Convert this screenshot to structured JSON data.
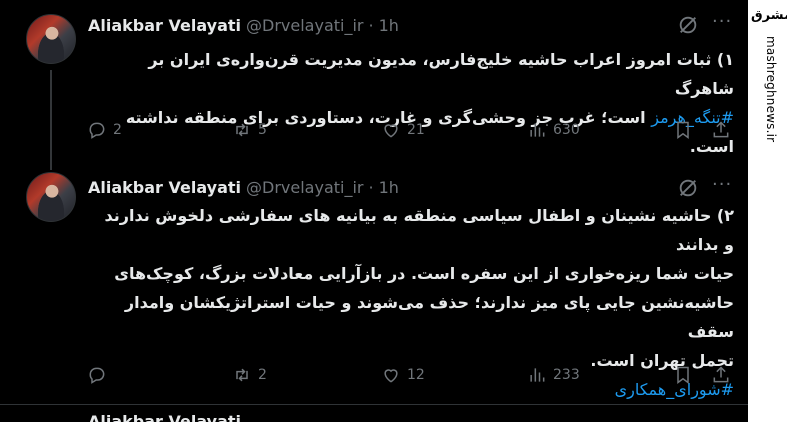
{
  "tweets": [
    {
      "author_name": "Aliakbar Velayati",
      "author_handle": "@Drvelayati_ir",
      "separator": "·",
      "time": "1h",
      "text_lines": [
        "۱) ثبات امروز اعراب حاشیه خلیج‌فارس، مدیون مدیریت قرن‌واره‌ی ایران بر شاهرگ",
        "است؛ غرب جز وحشی‌گری و غارت، دستاوردی برای منطقه نداشته است."
      ],
      "hashtag": "#تنگه_هرمز",
      "replies": "2",
      "reposts": "5",
      "likes": "21",
      "views": "630"
    },
    {
      "author_name": "Aliakbar Velayati",
      "author_handle": "@Drvelayati_ir",
      "separator": "·",
      "time": "1h",
      "text_lines": [
        "۲) حاشیه نشینان و اطفال سیاسی منطقه به بیانیه های سفارشی دلخوش ندارند و بدانند",
        "حیات شما ریزه‌خواری از این سفره است. در بازآرایی معادلات بزرگ، کوچک‌های",
        "حاشیه‌نشین جایی پای میز ندارند؛ حذف می‌شوند و حیات استراتژیکشان وامدار سقف",
        "تحمل تهران است."
      ],
      "hashtag": "#شورای_همکاری",
      "replies": "",
      "reposts": "2",
      "likes": "12",
      "views": "233"
    }
  ],
  "next_tweet_name": "Aliakbar Velayati",
  "watermark": {
    "logo": "مشرق",
    "site": "mashreghnews.ir"
  },
  "colors": {
    "background": "#000000",
    "text": "#e7e9ea",
    "muted": "#71767b",
    "link": "#1d9bf0",
    "divider": "#2f3336"
  },
  "icons": [
    "reply-icon",
    "repost-icon",
    "like-icon",
    "views-icon",
    "bookmark-icon",
    "share-icon",
    "grok-icon",
    "more-icon"
  ]
}
